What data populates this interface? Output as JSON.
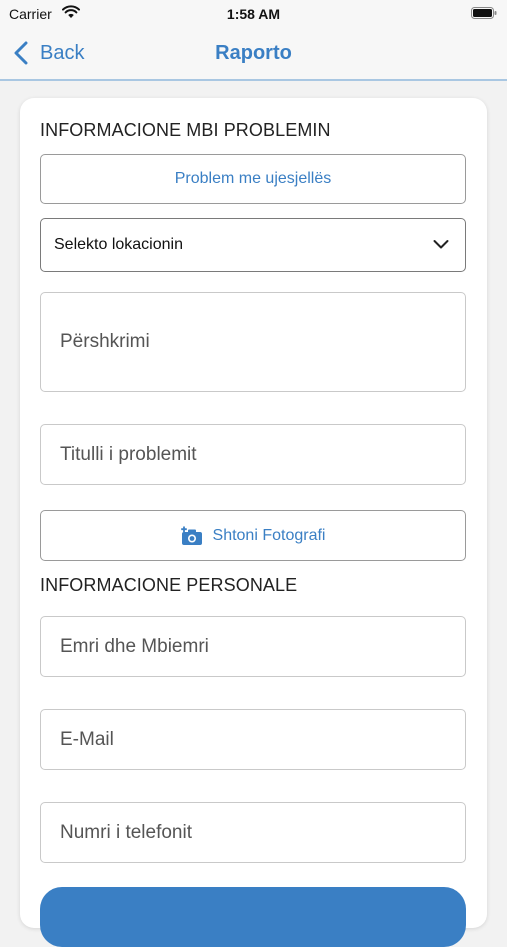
{
  "status_bar": {
    "carrier": "Carrier",
    "time": "1:58 AM"
  },
  "nav": {
    "back_label": "Back",
    "title": "Raporto"
  },
  "problem_section": {
    "title": "INFORMACIONE MBI PROBLEMIN",
    "type_button": "Problem me ujesjellës",
    "location_select": "Selekto lokacionin",
    "description_placeholder": "Përshkrimi",
    "problem_title_placeholder": "Titulli i problemit",
    "add_photo_button": "Shtoni Fotografi"
  },
  "personal_section": {
    "title": "INFORMACIONE PERSONALE",
    "name_placeholder": "Emri dhe Mbiemri",
    "email_placeholder": "E-Mail",
    "phone_placeholder": "Numri i telefonit"
  },
  "colors": {
    "accent": "#3a7fc4",
    "background": "#f2f2f2"
  },
  "icons": [
    "wifi-icon",
    "battery-icon",
    "chevron-left-icon",
    "chevron-down-icon",
    "camera-plus-icon"
  ]
}
